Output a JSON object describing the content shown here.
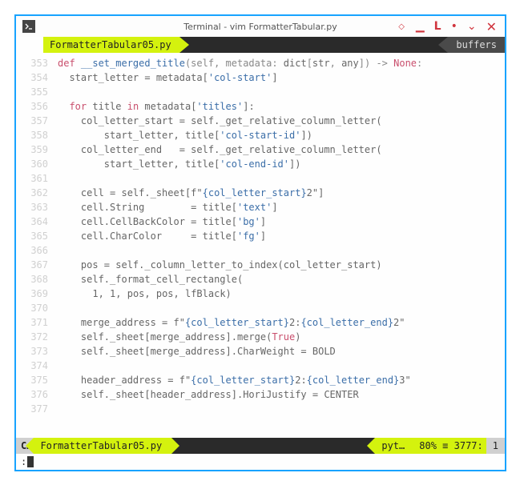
{
  "window": {
    "title": "Terminal - vim FormatterTabular.py"
  },
  "tabline": {
    "active_tab": "FormatterTabular05.py",
    "buffers_label": "buffers"
  },
  "editor": {
    "first_line": 353,
    "lines": [
      {
        "n": "353",
        "seg": [
          {
            "c": "k-def",
            "t": "def "
          },
          {
            "c": "fn",
            "t": "__set_merged_title"
          },
          {
            "c": "pun",
            "t": "(self, metadata: "
          },
          {
            "c": "type",
            "t": "dict"
          },
          {
            "c": "pun",
            "t": "["
          },
          {
            "c": "type",
            "t": "str"
          },
          {
            "c": "pun",
            "t": ", "
          },
          {
            "c": "type",
            "t": "any"
          },
          {
            "c": "pun",
            "t": "]) "
          },
          {
            "c": "arrow",
            "t": "-> "
          },
          {
            "c": "k-none",
            "t": "None"
          },
          {
            "c": "pun",
            "t": ":"
          }
        ]
      },
      {
        "n": "354",
        "seg": [
          {
            "c": "ident",
            "t": "  start_letter = metadata["
          },
          {
            "c": "str",
            "t": "'col-start'"
          },
          {
            "c": "ident",
            "t": "]"
          }
        ]
      },
      {
        "n": "355",
        "seg": [
          {
            "c": "ident",
            "t": ""
          }
        ]
      },
      {
        "n": "356",
        "seg": [
          {
            "c": "ident",
            "t": "  "
          },
          {
            "c": "k-for",
            "t": "for"
          },
          {
            "c": "ident",
            "t": " title "
          },
          {
            "c": "k-in",
            "t": "in"
          },
          {
            "c": "ident",
            "t": " metadata["
          },
          {
            "c": "str",
            "t": "'titles'"
          },
          {
            "c": "ident",
            "t": "]:"
          }
        ]
      },
      {
        "n": "357",
        "seg": [
          {
            "c": "ident",
            "t": "    col_letter_start = self._get_relative_column_letter("
          }
        ]
      },
      {
        "n": "358",
        "seg": [
          {
            "c": "ident",
            "t": "        start_letter, title["
          },
          {
            "c": "str",
            "t": "'col-start-id'"
          },
          {
            "c": "ident",
            "t": "])"
          }
        ]
      },
      {
        "n": "359",
        "seg": [
          {
            "c": "ident",
            "t": "    col_letter_end   = self._get_relative_column_letter("
          }
        ]
      },
      {
        "n": "360",
        "seg": [
          {
            "c": "ident",
            "t": "        start_letter, title["
          },
          {
            "c": "str",
            "t": "'col-end-id'"
          },
          {
            "c": "ident",
            "t": "])"
          }
        ]
      },
      {
        "n": "361",
        "seg": [
          {
            "c": "ident",
            "t": ""
          }
        ]
      },
      {
        "n": "362",
        "seg": [
          {
            "c": "ident",
            "t": "    cell = self._sheet[f\""
          },
          {
            "c": "interp",
            "t": "{col_letter_start}"
          },
          {
            "c": "ident",
            "t": "2\"]"
          }
        ]
      },
      {
        "n": "363",
        "seg": [
          {
            "c": "ident",
            "t": "    cell.String        = title["
          },
          {
            "c": "str",
            "t": "'text'"
          },
          {
            "c": "ident",
            "t": "]"
          }
        ]
      },
      {
        "n": "364",
        "seg": [
          {
            "c": "ident",
            "t": "    cell.CellBackColor = title["
          },
          {
            "c": "str",
            "t": "'bg'"
          },
          {
            "c": "ident",
            "t": "]"
          }
        ]
      },
      {
        "n": "365",
        "seg": [
          {
            "c": "ident",
            "t": "    cell.CharColor     = title["
          },
          {
            "c": "str",
            "t": "'fg'"
          },
          {
            "c": "ident",
            "t": "]"
          }
        ]
      },
      {
        "n": "366",
        "seg": [
          {
            "c": "ident",
            "t": ""
          }
        ]
      },
      {
        "n": "367",
        "seg": [
          {
            "c": "ident",
            "t": "    pos = self._column_letter_to_index(col_letter_start)"
          }
        ]
      },
      {
        "n": "368",
        "seg": [
          {
            "c": "ident",
            "t": "    self._format_cell_rectangle("
          }
        ]
      },
      {
        "n": "369",
        "seg": [
          {
            "c": "ident",
            "t": "      "
          },
          {
            "c": "num",
            "t": "1"
          },
          {
            "c": "ident",
            "t": ", "
          },
          {
            "c": "num",
            "t": "1"
          },
          {
            "c": "ident",
            "t": ", pos, pos, lfBlack)"
          }
        ]
      },
      {
        "n": "370",
        "seg": [
          {
            "c": "ident",
            "t": ""
          }
        ]
      },
      {
        "n": "371",
        "seg": [
          {
            "c": "ident",
            "t": "    merge_address = f\""
          },
          {
            "c": "interp",
            "t": "{col_letter_start}"
          },
          {
            "c": "ident",
            "t": "2:"
          },
          {
            "c": "interp",
            "t": "{col_letter_end}"
          },
          {
            "c": "ident",
            "t": "2\""
          }
        ]
      },
      {
        "n": "372",
        "seg": [
          {
            "c": "ident",
            "t": "    self._sheet[merge_address].merge("
          },
          {
            "c": "k-none",
            "t": "True"
          },
          {
            "c": "ident",
            "t": ")"
          }
        ]
      },
      {
        "n": "373",
        "seg": [
          {
            "c": "ident",
            "t": "    self._sheet[merge_address].CharWeight = BOLD"
          }
        ]
      },
      {
        "n": "374",
        "seg": [
          {
            "c": "ident",
            "t": ""
          }
        ]
      },
      {
        "n": "375",
        "seg": [
          {
            "c": "ident",
            "t": "    header_address = f\""
          },
          {
            "c": "interp",
            "t": "{col_letter_start}"
          },
          {
            "c": "ident",
            "t": "2:"
          },
          {
            "c": "interp",
            "t": "{col_letter_end}"
          },
          {
            "c": "ident",
            "t": "3\""
          }
        ]
      },
      {
        "n": "376",
        "seg": [
          {
            "c": "ident",
            "t": "    self._sheet[header_address].HoriJustify = CENTER"
          }
        ]
      },
      {
        "n": "377",
        "seg": [
          {
            "c": "ident",
            "t": ""
          }
        ]
      }
    ]
  },
  "statusline": {
    "mode": "C…",
    "file": "FormatterTabular05.py",
    "filetype": "pyt…",
    "percent": "80%",
    "line": "3777",
    "col": "1"
  },
  "cmdline": {
    "text": ":"
  }
}
